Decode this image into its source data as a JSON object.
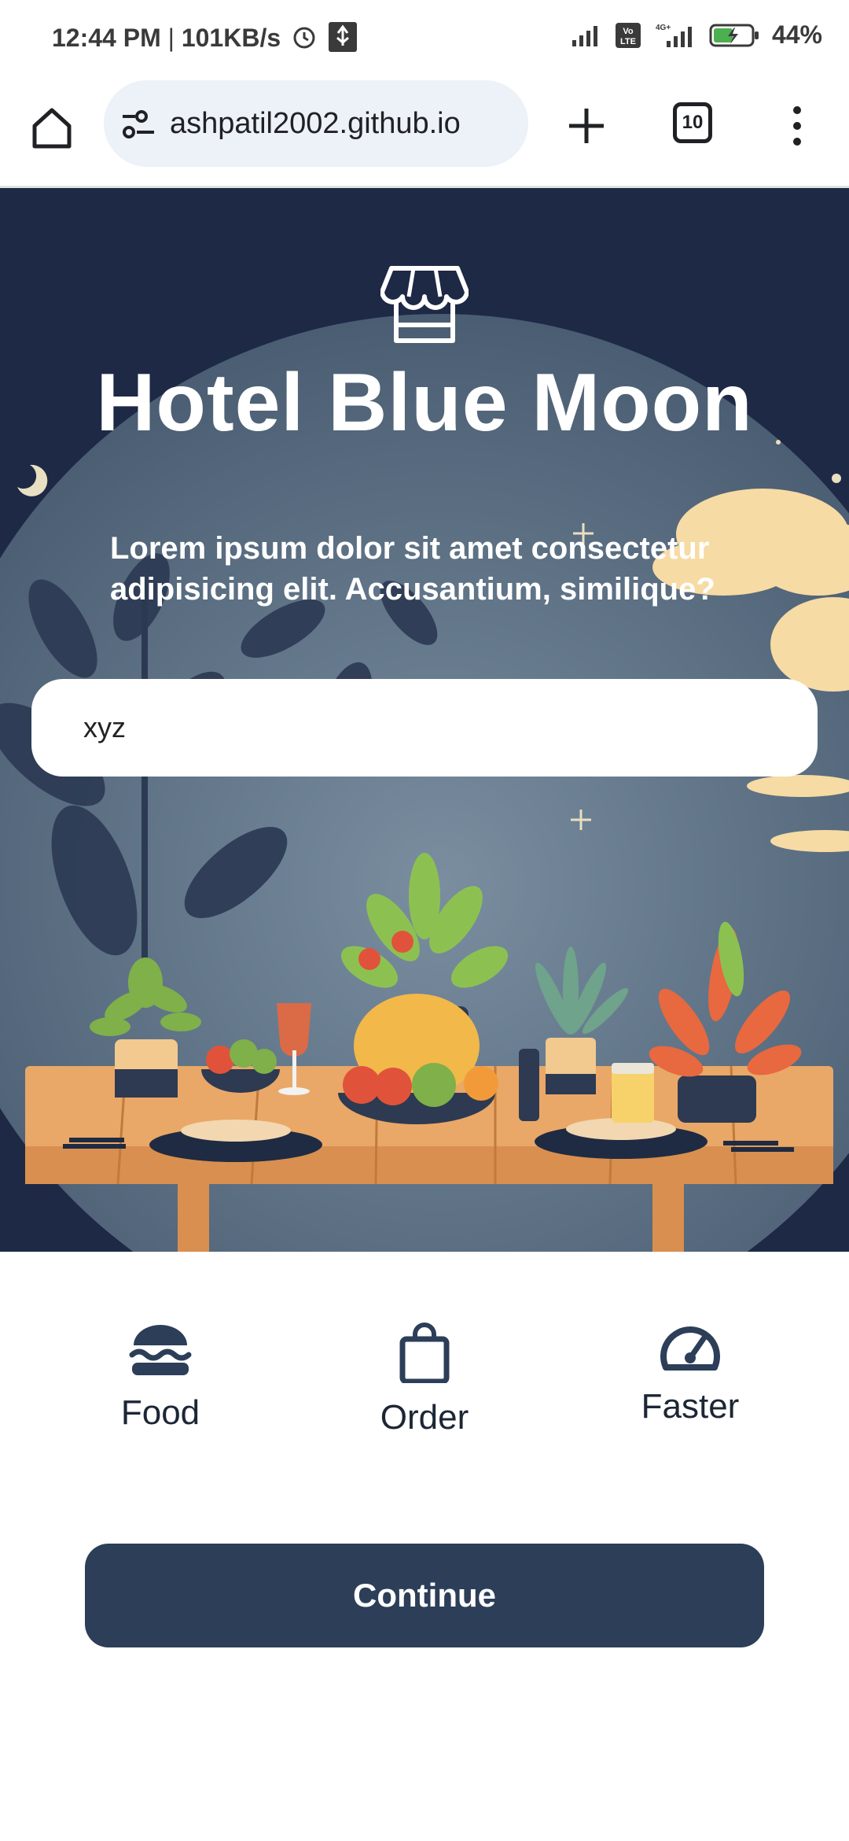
{
  "status_bar": {
    "time": "12:44 PM",
    "speed": "101KB/s",
    "separator": "|",
    "network_label_1": "Vo LTE",
    "network_label_2": "4G+",
    "battery": "44%",
    "icons": [
      "alarm-icon",
      "usb-icon",
      "signal-icon",
      "volte-icon",
      "signal-4g-icon",
      "battery-charging-icon"
    ]
  },
  "browser": {
    "url": "ashpatil2002.github.io",
    "tab_count": "10",
    "icons": [
      "home-icon",
      "site-settings-icon",
      "new-tab-icon",
      "tabs-icon",
      "more-menu-icon"
    ]
  },
  "hero": {
    "title": "Hotel Blue Moon",
    "subtitle": "Lorem ipsum dolor sit amet consectetur adipisicing elit. Accusantium, similique?",
    "input_value": "xyz",
    "icon": "store-icon"
  },
  "features": [
    {
      "label": "Food",
      "icon": "burger-icon"
    },
    {
      "label": "Order",
      "icon": "shopping-bag-icon"
    },
    {
      "label": "Faster",
      "icon": "speedometer-icon"
    }
  ],
  "continue_label": "Continue",
  "colors": {
    "primary": "#2c3e58",
    "hero_bg": "#1e2946",
    "text_dark": "#1c2635"
  }
}
